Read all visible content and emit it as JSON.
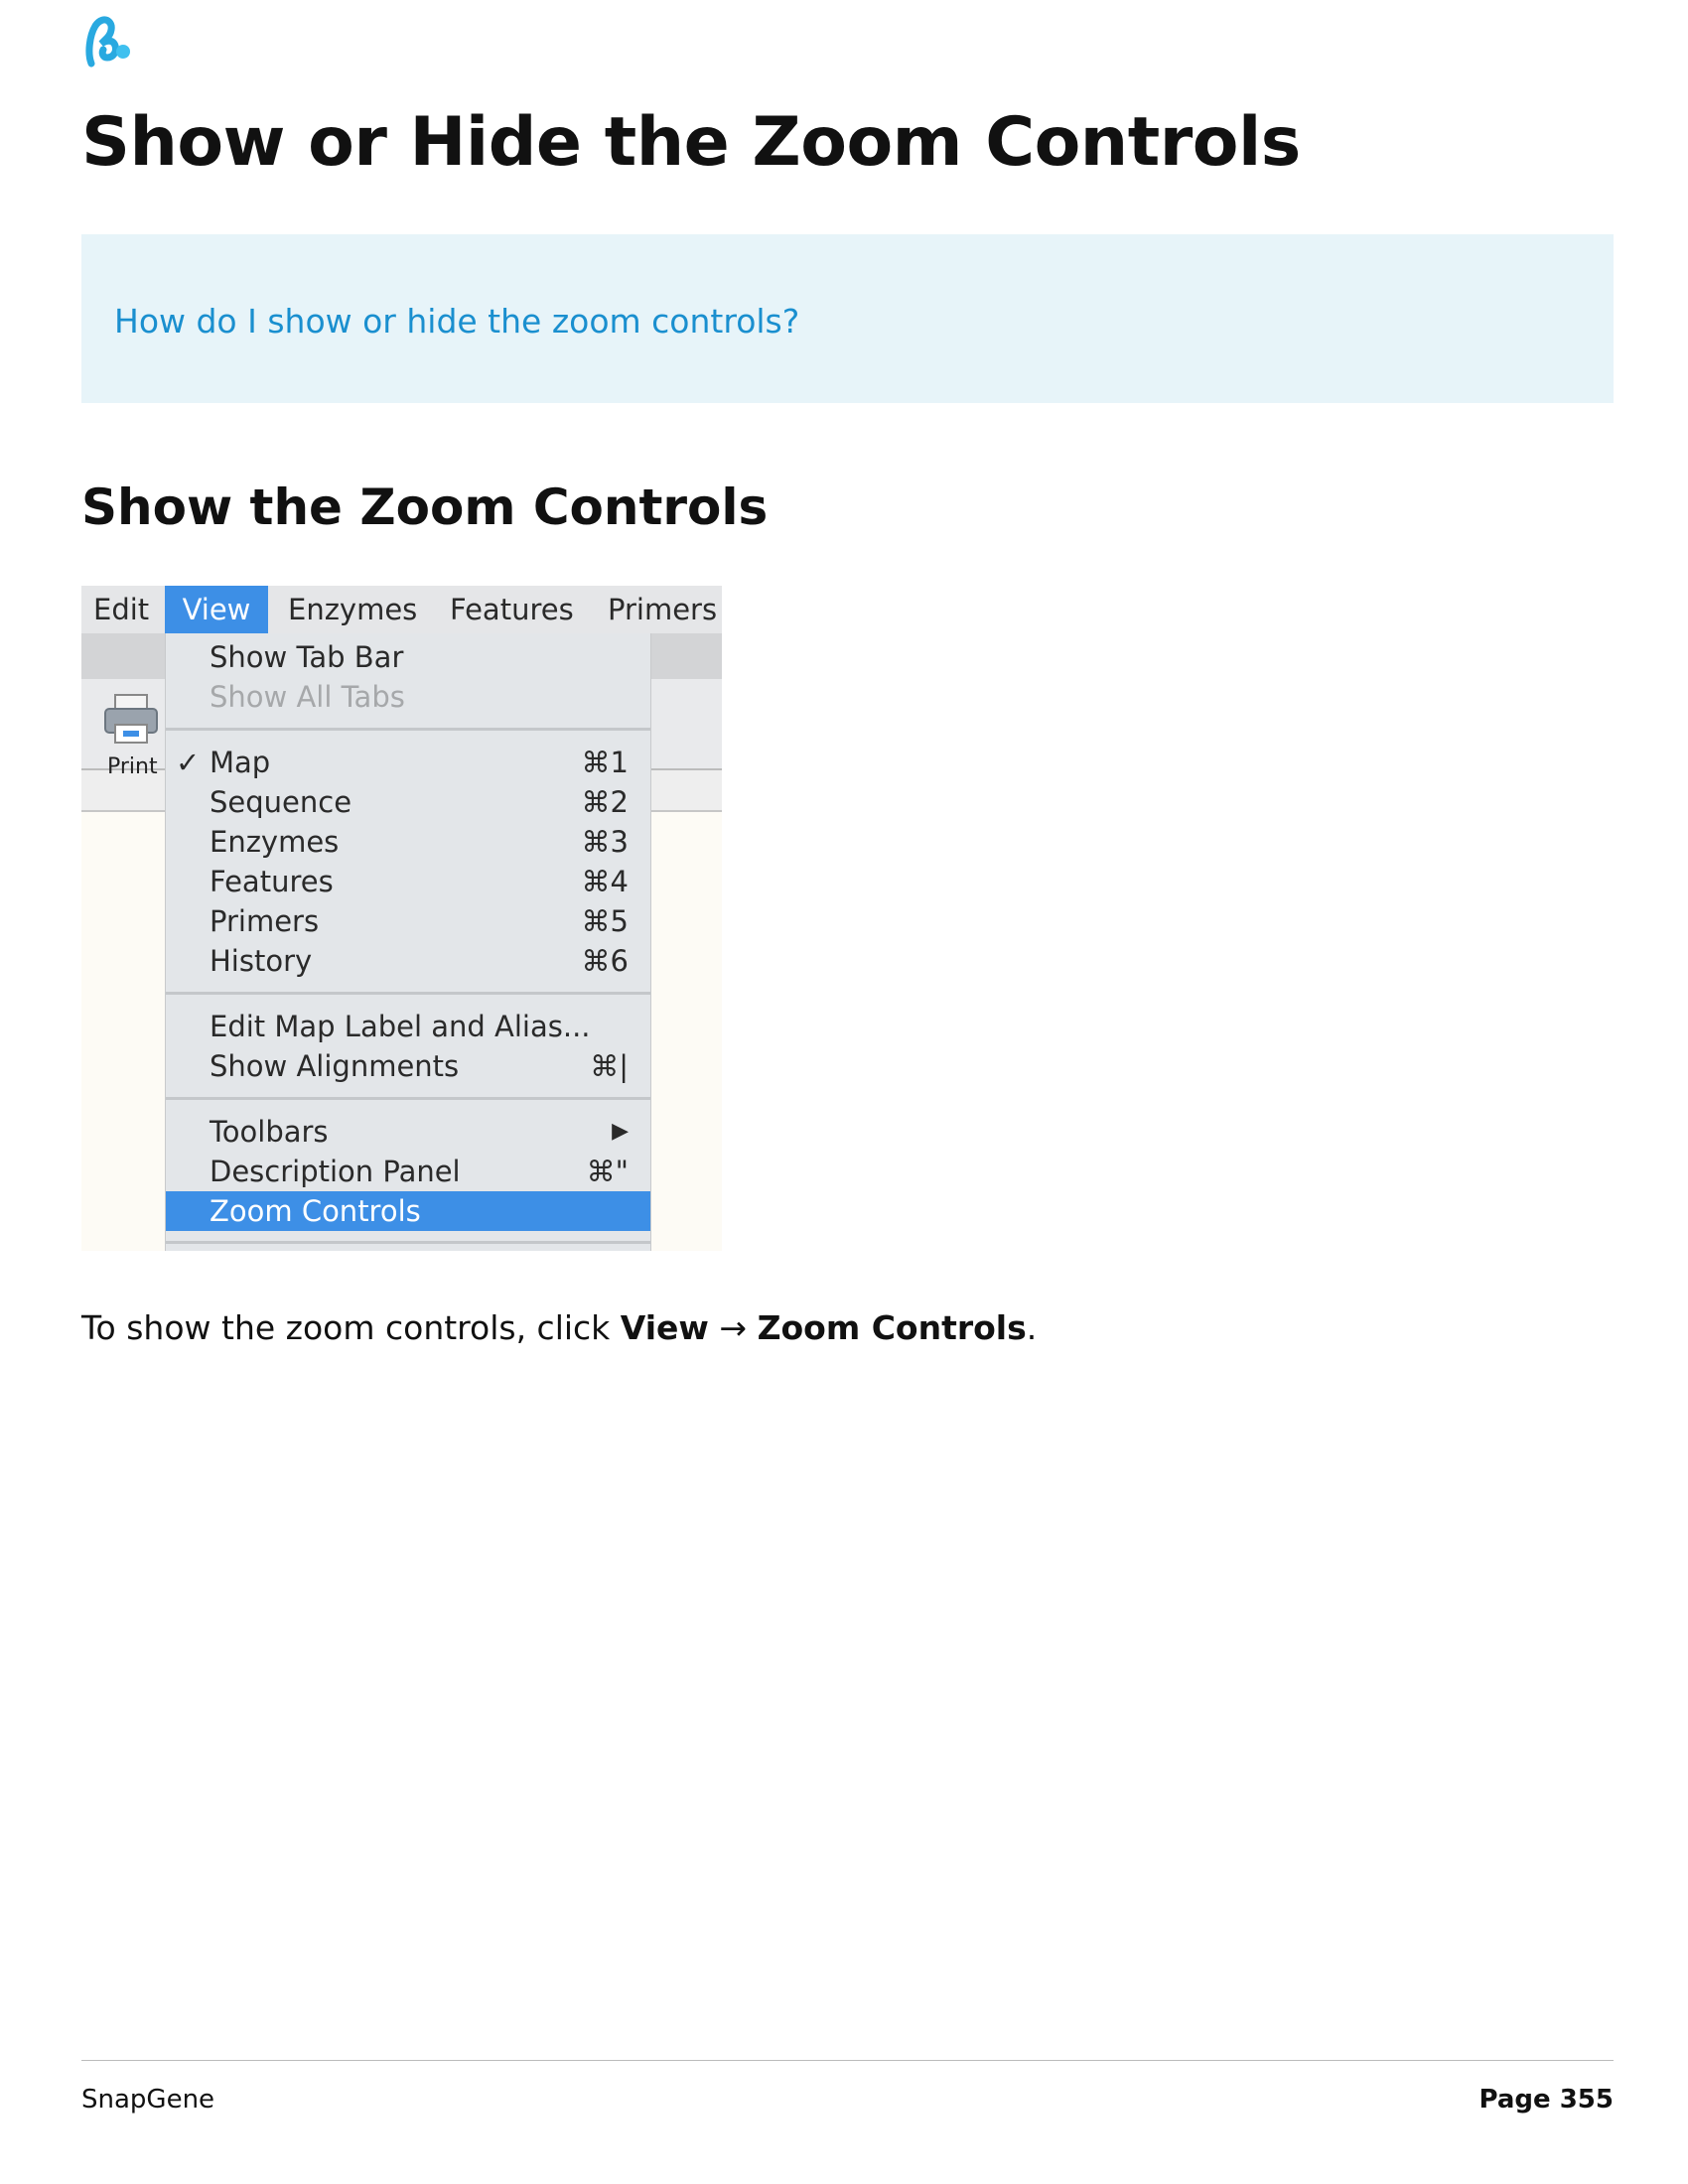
{
  "document": {
    "title": "Show or Hide the Zoom Controls",
    "question": "How do I show or hide the zoom controls?",
    "section_heading": "Show the Zoom Controls",
    "caption": {
      "prefix": "To show the zoom controls, click ",
      "view": "View",
      "arrow": " → ",
      "zoom_controls": "Zoom Controls",
      "suffix": "."
    }
  },
  "screenshot": {
    "menubar": [
      "Edit",
      "View",
      "Enzymes",
      "Features",
      "Primers"
    ],
    "toolbar": {
      "print_label": "Print"
    },
    "view_menu": {
      "show_tab_bar": "Show Tab Bar",
      "show_all_tabs": "Show All Tabs",
      "check_mark": "✓",
      "map": {
        "label": "Map",
        "shortcut": "⌘1"
      },
      "sequence": {
        "label": "Sequence",
        "shortcut": "⌘2"
      },
      "enzymes": {
        "label": "Enzymes",
        "shortcut": "⌘3"
      },
      "features": {
        "label": "Features",
        "shortcut": "⌘4"
      },
      "primers": {
        "label": "Primers",
        "shortcut": "⌘5"
      },
      "history": {
        "label": "History",
        "shortcut": "⌘6"
      },
      "edit_map_label": "Edit Map Label and Alias...",
      "show_alignments": {
        "label": "Show Alignments",
        "shortcut": "⌘|"
      },
      "toolbars": {
        "label": "Toolbars",
        "submenu_arrow": "▶"
      },
      "description_panel": {
        "label": "Description Panel",
        "shortcut": "⌘\""
      },
      "zoom_controls": "Zoom Controls"
    }
  },
  "footer": {
    "brand": "SnapGene",
    "page": "Page 355"
  },
  "colors": {
    "link_blue": "#1a8fcf",
    "callout_bg": "#e7f4f9",
    "menu_highlight": "#3d8fe6"
  }
}
